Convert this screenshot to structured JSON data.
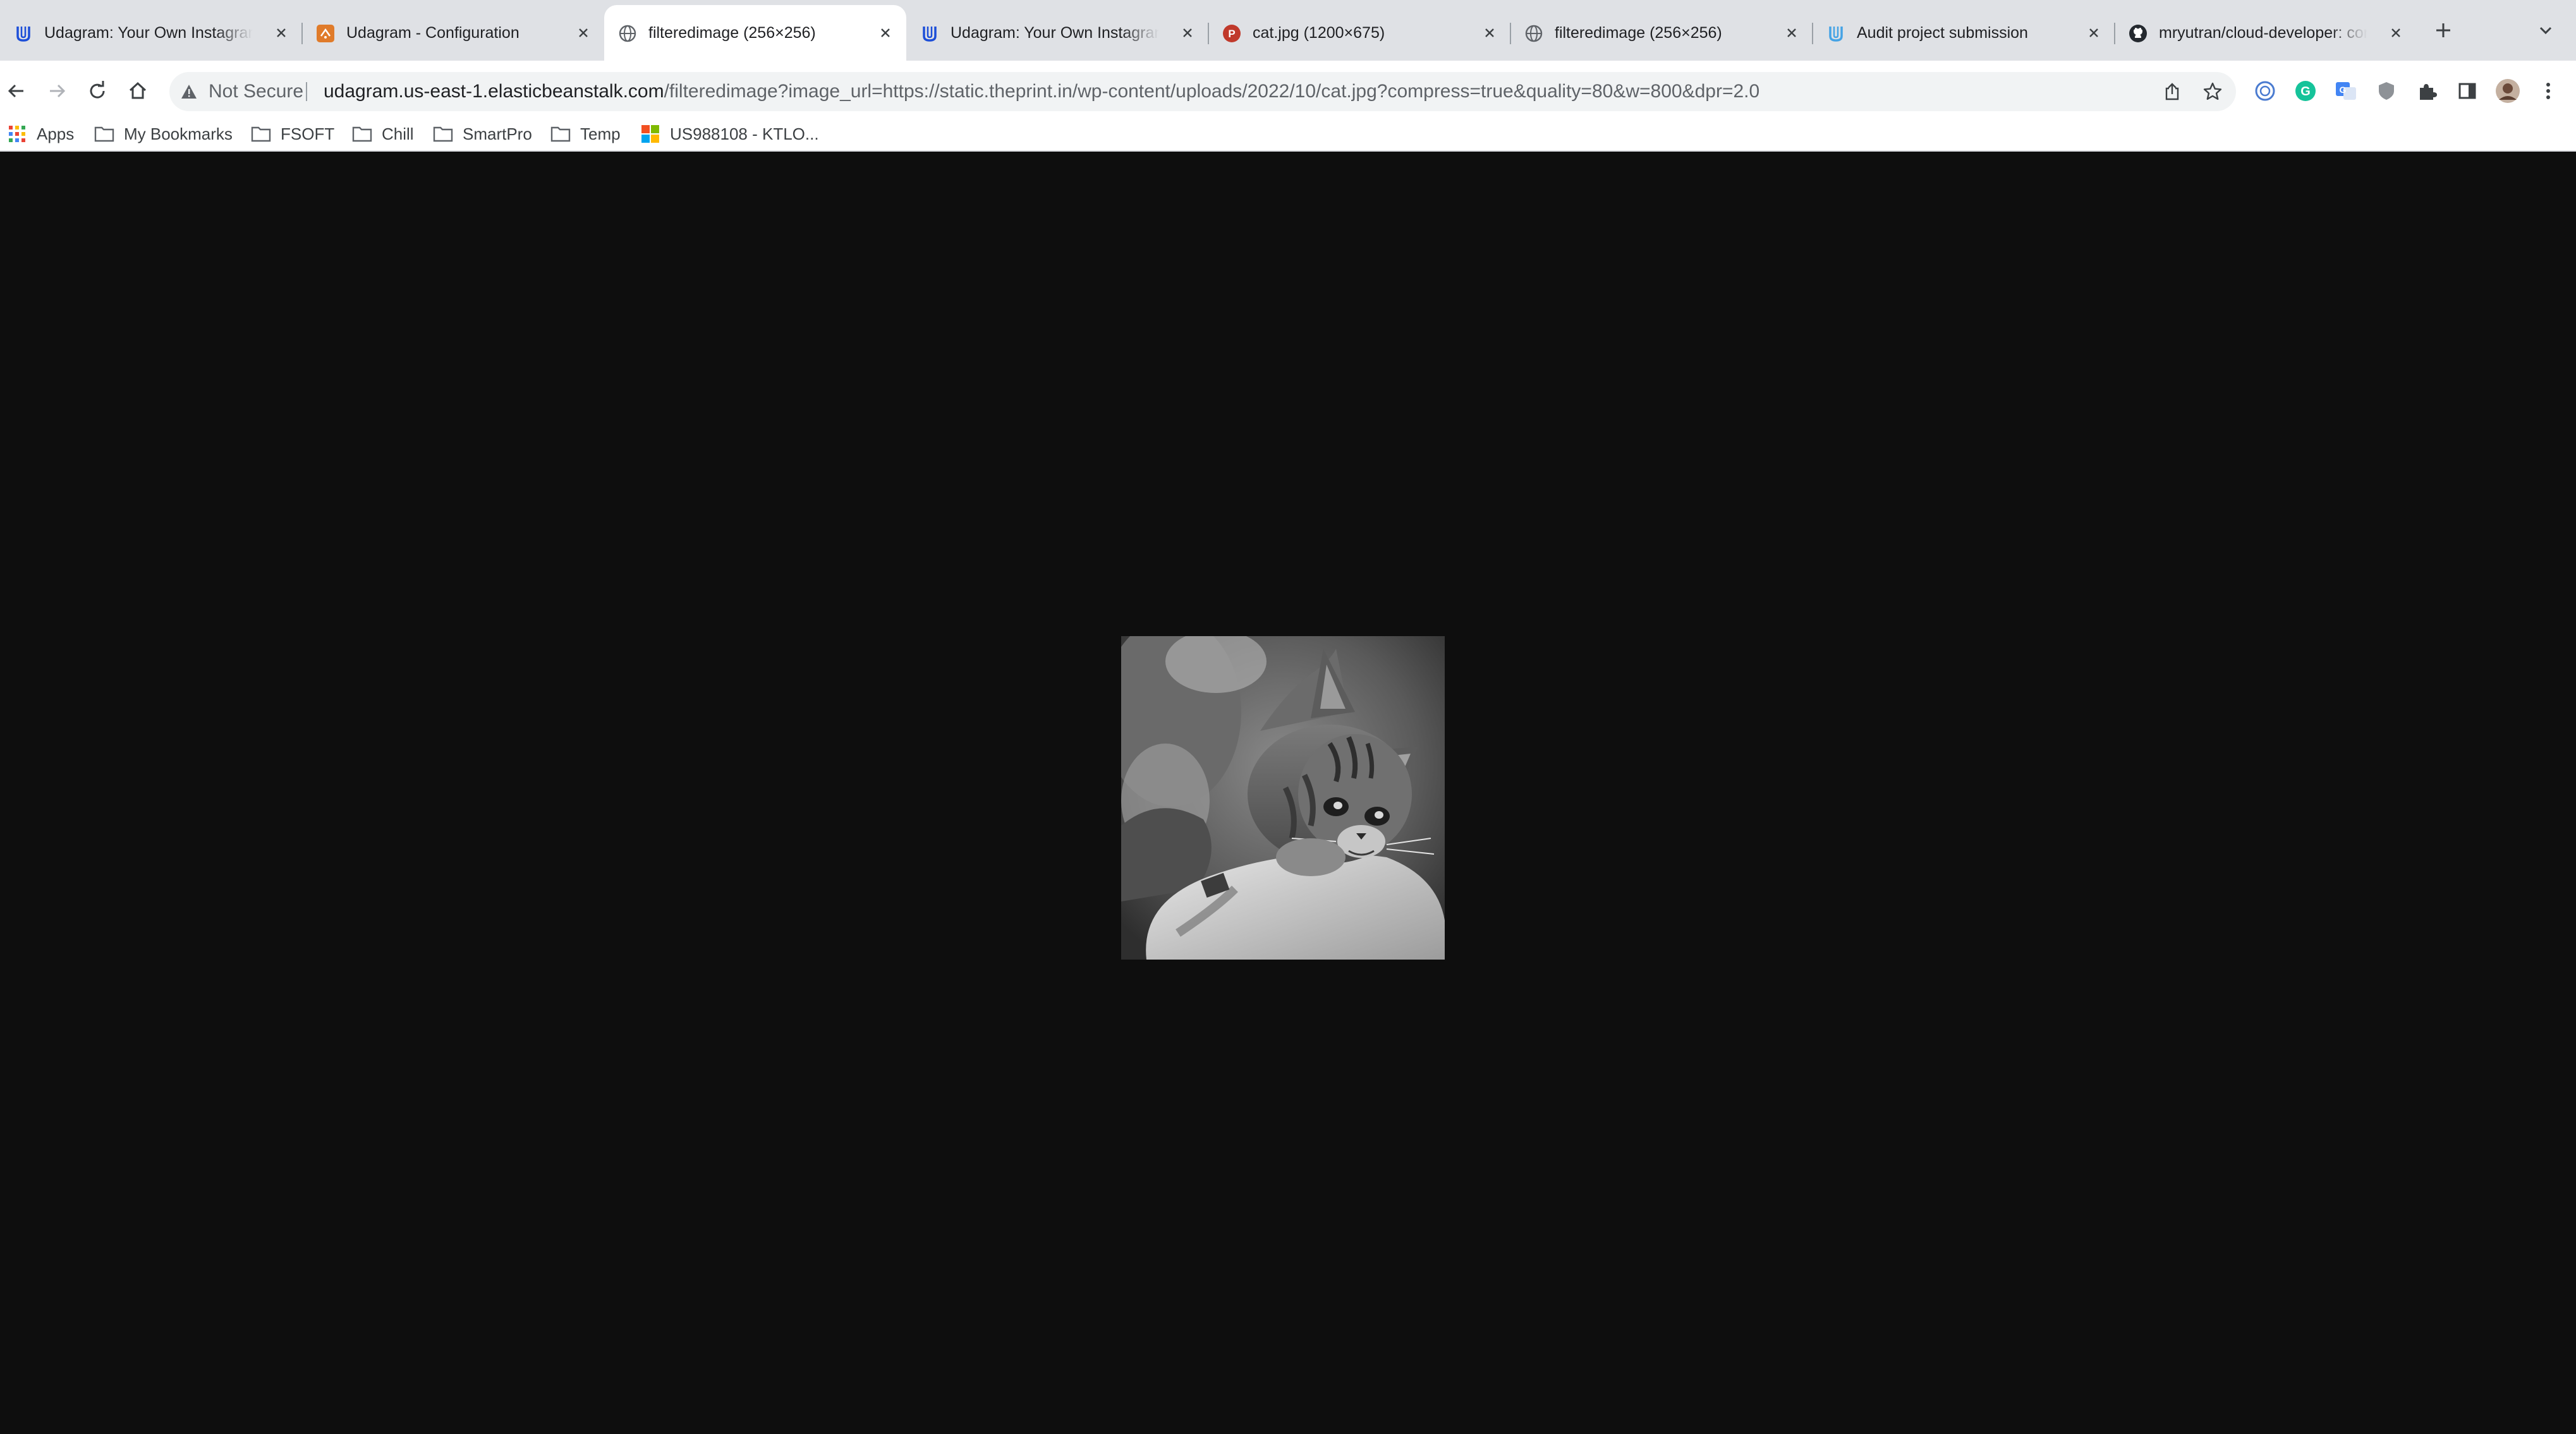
{
  "tabs": [
    {
      "title": "Udagram: Your Own Instagram",
      "icon": "udacity-icon"
    },
    {
      "title": "Udagram - Configuration",
      "icon": "aws-icon"
    },
    {
      "title": "filteredimage (256×256)",
      "icon": "globe-icon",
      "active": true
    },
    {
      "title": "Udagram: Your Own Instagram",
      "icon": "udacity-icon"
    },
    {
      "title": "cat.jpg (1200×675)",
      "icon": "p-badge-icon"
    },
    {
      "title": "filteredimage (256×256)",
      "icon": "globe-icon"
    },
    {
      "title": "Audit project submission",
      "icon": "udacity-icon"
    },
    {
      "title": "mryutran/cloud-developer: cor",
      "icon": "github-icon"
    }
  ],
  "omnibox": {
    "security_label": "Not Secure",
    "url_host": "udagram.us-east-1.elasticbeanstalk.com",
    "url_path": "/filteredimage?image_url=https://static.theprint.in/wp-content/uploads/2022/10/cat.jpg?compress=true&quality=80&w=800&dpr=2.0"
  },
  "bookmarks": [
    {
      "label": "Apps",
      "icon": "apps-grid-icon"
    },
    {
      "label": "My Bookmarks",
      "icon": "folder-icon"
    },
    {
      "label": "FSOFT",
      "icon": "folder-icon"
    },
    {
      "label": "Chill",
      "icon": "folder-icon"
    },
    {
      "label": "SmartPro",
      "icon": "folder-icon"
    },
    {
      "label": "Temp",
      "icon": "folder-icon"
    },
    {
      "label": "US988108 - KTLO...",
      "icon": "microsoft-icon"
    }
  ],
  "content": {
    "image_alt": "grayscale cat photo"
  },
  "colors": {
    "tabstrip_bg": "#dfe1e5",
    "page_bg": "#0e0e0e",
    "udacity_accent": "#1c4ed8",
    "aws_orange": "#e07b2a",
    "p_badge": "#c0392b"
  }
}
